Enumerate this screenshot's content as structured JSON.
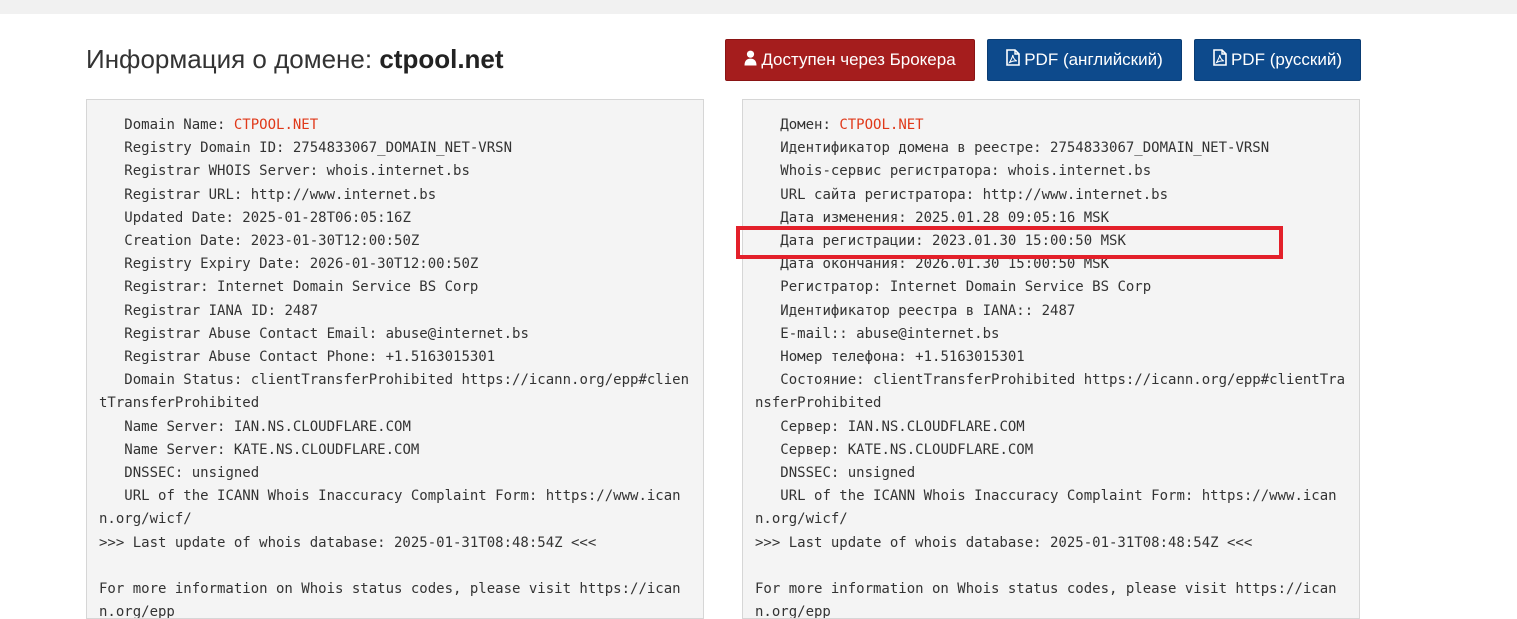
{
  "header": {
    "title_prefix": "Информация о домене: ",
    "domain": "ctpool.net"
  },
  "buttons": {
    "broker": "Доступен через Брокера",
    "pdf_en": "PDF (английский)",
    "pdf_ru": "PDF (русский)"
  },
  "colors": {
    "broker_button": "#a51d1d",
    "pdf_button": "#0d4a8c",
    "domain_highlight": "#e0391a",
    "annotation_box": "#e3202a"
  },
  "icons": {
    "broker": "user-icon",
    "pdf": "file-pdf-icon"
  },
  "whois_en": {
    "domain_label": "   Domain Name: ",
    "domain_value": "CTPOOL.NET",
    "body": "\n   Registry Domain ID: 2754833067_DOMAIN_NET-VRSN\n   Registrar WHOIS Server: whois.internet.bs\n   Registrar URL: http://www.internet.bs\n   Updated Date: 2025-01-28T06:05:16Z\n   Creation Date: 2023-01-30T12:00:50Z\n   Registry Expiry Date: 2026-01-30T12:00:50Z\n   Registrar: Internet Domain Service BS Corp\n   Registrar IANA ID: 2487\n   Registrar Abuse Contact Email: abuse@internet.bs\n   Registrar Abuse Contact Phone: +1.5163015301\n   Domain Status: clientTransferProhibited https://icann.org/epp#clientTransferProhibited\n   Name Server: IAN.NS.CLOUDFLARE.COM\n   Name Server: KATE.NS.CLOUDFLARE.COM\n   DNSSEC: unsigned\n   URL of the ICANN Whois Inaccuracy Complaint Form: https://www.icann.org/wicf/\n>>> Last update of whois database: 2025-01-31T08:48:54Z <<<\n\nFor more information on Whois status codes, please visit https://icann.org/epp"
  },
  "whois_ru": {
    "domain_label": "   Домен: ",
    "domain_value": "CTPOOL.NET",
    "body": "\n   Идентификатор домена в реестре: 2754833067_DOMAIN_NET-VRSN\n   Whois-сервис регистратора: whois.internet.bs\n   URL сайта регистратора: http://www.internet.bs\n   Дата изменения: 2025.01.28 09:05:16 MSK\n   Дата регистрации: 2023.01.30 15:00:50 MSK\n   Дата окончания: 2026.01.30 15:00:50 MSK\n   Регистратор: Internet Domain Service BS Corp\n   Идентификатор реестра в IANA:: 2487\n   E-mail:: abuse@internet.bs\n   Номер телефона: +1.5163015301\n   Состояние: clientTransferProhibited https://icann.org/epp#clientTransferProhibited\n   Сервер: IAN.NS.CLOUDFLARE.COM\n   Сервер: KATE.NS.CLOUDFLARE.COM\n   DNSSEC: unsigned\n   URL of the ICANN Whois Inaccuracy Complaint Form: https://www.icann.org/wicf/\n>>> Last update of whois database: 2025-01-31T08:48:54Z <<<\n\nFor more information on Whois status codes, please visit https://icann.org/epp"
  }
}
